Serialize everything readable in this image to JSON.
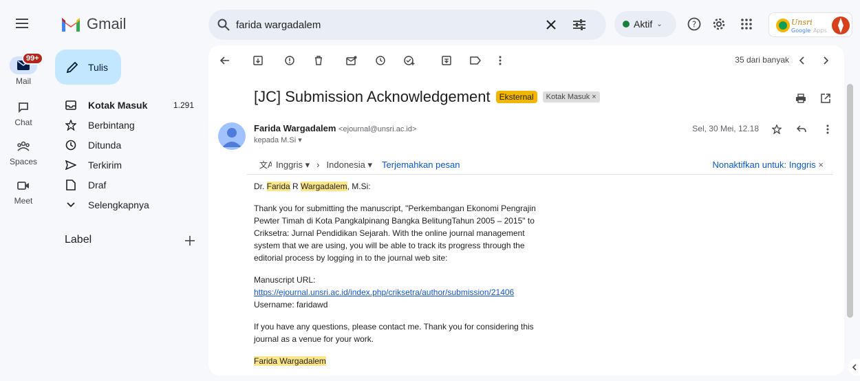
{
  "app": {
    "name": "Gmail"
  },
  "search": {
    "value": "farida wargadalem"
  },
  "status": {
    "label": "Aktif"
  },
  "org_logo": {
    "label": "Unsri Google Apps"
  },
  "rail": [
    {
      "label": "Mail",
      "badge": "99+"
    },
    {
      "label": "Chat"
    },
    {
      "label": "Spaces"
    },
    {
      "label": "Meet"
    }
  ],
  "compose": {
    "label": "Tulis"
  },
  "nav": [
    {
      "label": "Kotak Masuk",
      "count": "1.291",
      "icon": "inbox-icon"
    },
    {
      "label": "Berbintang",
      "count": "",
      "icon": "star-icon"
    },
    {
      "label": "Ditunda",
      "count": "",
      "icon": "clock-icon"
    },
    {
      "label": "Terkirim",
      "count": "",
      "icon": "send-icon"
    },
    {
      "label": "Draf",
      "count": "",
      "icon": "draft-icon"
    },
    {
      "label": "Selengkapnya",
      "count": "",
      "icon": "chevron-down-icon"
    }
  ],
  "labels": {
    "heading": "Label"
  },
  "toolbar": {
    "pager": "35 dari banyak"
  },
  "message": {
    "subject": "[JC] Submission Acknowledgement",
    "tag_external": "Eksternal",
    "label_chip": "Kotak Masuk",
    "sender_name": "Farida Wargadalem",
    "sender_email": "<ejournal@unsri.ac.id>",
    "to_line": "kepada M.Si",
    "date": "Sel, 30 Mei, 12.18"
  },
  "translate": {
    "from": "Inggris",
    "to": "Indonesia",
    "action": "Terjemahkan pesan",
    "disable": "Nonaktifkan untuk: Inggris"
  },
  "body": {
    "greet_1": "Dr. ",
    "greet_hl_1": "Farida",
    "greet_2": " R ",
    "greet_hl_2": "Wargadalem",
    "greet_3": ", M.Si:",
    "para1": "Thank you for submitting the manuscript, \"Perkembangan Ekonomi Pengrajin Pewter Timah di Kota Pangkalpinang Bangka BelitungTahun 2005 – 2015\" to Criksetra: Jurnal Pendidikan Sejarah. With the online journal management system that we are using, you will be able to track its progress through the editorial process by logging in to the journal web site:",
    "url_label": "Manuscript URL:",
    "url": "https://ejournal.unsri.ac.id/index.php/criksetra/author/submission/21406",
    "username": "Username: faridawd",
    "para3": "If you have any questions, please contact me. Thank you for considering this journal as a venue for your work.",
    "signature": "Farida Wargadalem"
  }
}
